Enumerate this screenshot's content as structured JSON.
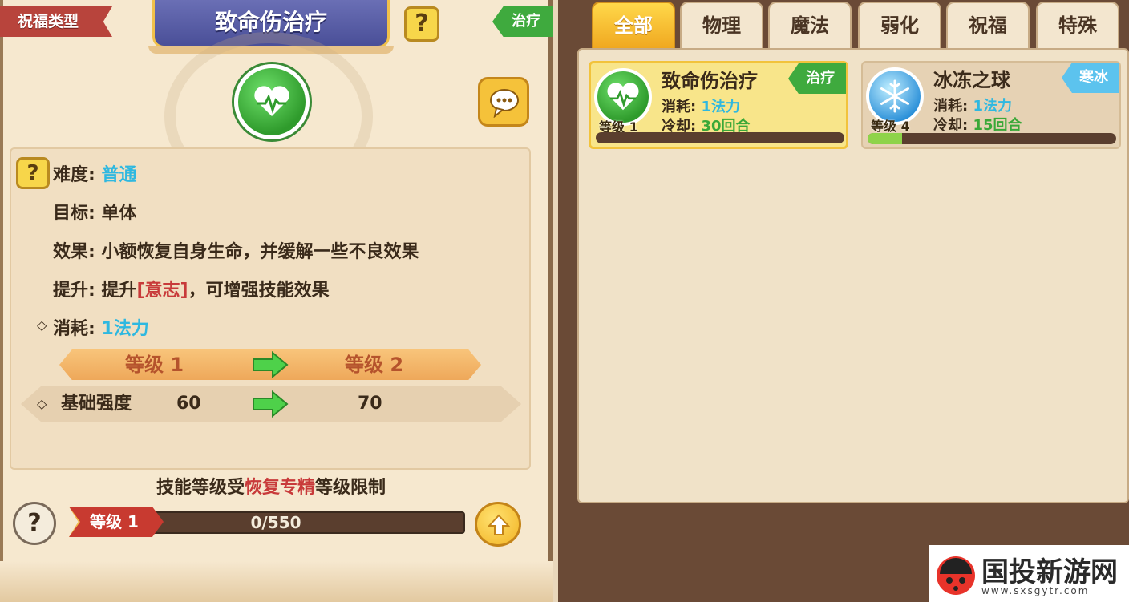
{
  "left": {
    "type_ribbon": "祝福类型",
    "title": "致命伤治疗",
    "help_glyph": "?",
    "type_tag": "治疗",
    "info": {
      "difficulty_label": "难度:",
      "difficulty_value": "普通",
      "target_label": "目标:",
      "target_value": "单体",
      "effect_label": "效果:",
      "effect_value": "小额恢复自身生命，并缓解一些不良效果",
      "upgrade_label": "提升:",
      "upgrade_prefix": "提升",
      "upgrade_attr": "[意志]",
      "upgrade_suffix": "，可增强技能效果",
      "cost_label": "消耗:",
      "cost_value": "1法力",
      "diamond": "◇"
    },
    "level_compare": {
      "from": "等级 1",
      "to": "等级 2"
    },
    "stat": {
      "name": "基础强度",
      "current": "60",
      "next": "70"
    },
    "limit": {
      "prefix": "技能等级受",
      "highlight": "恢复专精",
      "suffix": "等级限制"
    },
    "xp": {
      "level": "等级 1",
      "progress": "0/550"
    }
  },
  "tabs": [
    "全部",
    "物理",
    "魔法",
    "弱化",
    "祝福",
    "特殊"
  ],
  "skills": [
    {
      "name": "致命伤治疗",
      "tag": "治疗",
      "tag_color": "#3faa3e",
      "level": "等级 1",
      "cost_label": "消耗:",
      "cost": "1法力",
      "cooldown_label": "冷却:",
      "cooldown": "30回合",
      "progress": 0,
      "icon": "heart-pulse-icon"
    },
    {
      "name": "冰冻之球",
      "tag": "寒冰",
      "tag_color": "#5cc3ee",
      "level": "等级 4",
      "cost_label": "消耗:",
      "cost": "1法力",
      "cooldown_label": "冷却:",
      "cooldown": "15回合",
      "progress": 0.14,
      "icon": "snowflake-icon"
    }
  ],
  "watermark": {
    "name": "国投新游网",
    "url": "www.sxsgytr.com"
  }
}
